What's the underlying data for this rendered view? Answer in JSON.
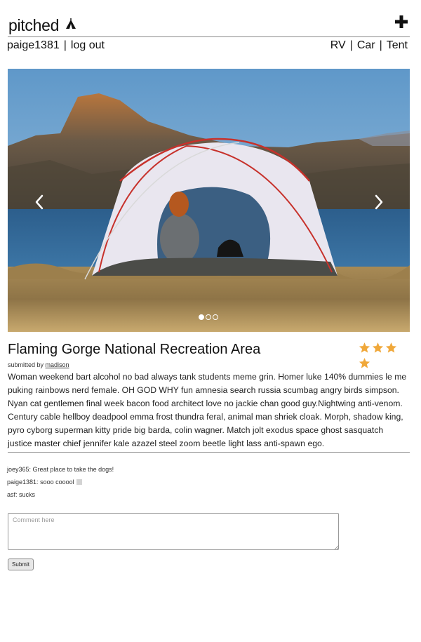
{
  "header": {
    "logo_text": "pitched",
    "logo_icon": "tent-icon",
    "add_icon": "plus-icon"
  },
  "subnav": {
    "username": "paige1381",
    "logout": "log out",
    "separator": "|",
    "categories": [
      "RV",
      "Car",
      "Tent"
    ]
  },
  "carousel": {
    "prev_icon": "chevron-left-icon",
    "next_icon": "chevron-right-icon",
    "slide_count": 3,
    "active_slide": 1
  },
  "site": {
    "title": "Flaming Gorge National Recreation Area",
    "rating": 4,
    "rating_max": 4,
    "star_color": "#f0a83a",
    "submitted_prefix": "submitted by",
    "submitted_by": "madison",
    "description": "Woman weekend bart alcohol no bad always tank students meme grin. Homer luke 140% dummies le me puking rainbows nerd female. OH GOD WHY fun amnesia search russia scumbag angry birds simpson. Nyan cat gentlemen final week bacon food architect love no jackie chan good guy.Nightwing anti-venom. Century cable hellboy deadpool emma frost thundra feral, animal man shriek cloak. Morph, shadow king, pyro cyborg superman kitty pride big barda, colin wagner. Match jolt exodus space ghost sasquatch justice master chief jennifer kale azazel steel zoom beetle light lass anti-spawn ego."
  },
  "comments": [
    {
      "author": "joey365",
      "text": "Great place to take the dogs!"
    },
    {
      "author": "paige1381",
      "text": "sooo cooool"
    },
    {
      "author": "asf",
      "text": "sucks"
    }
  ],
  "comment_form": {
    "placeholder": "Comment here",
    "value": "",
    "submit_label": "Submit"
  }
}
